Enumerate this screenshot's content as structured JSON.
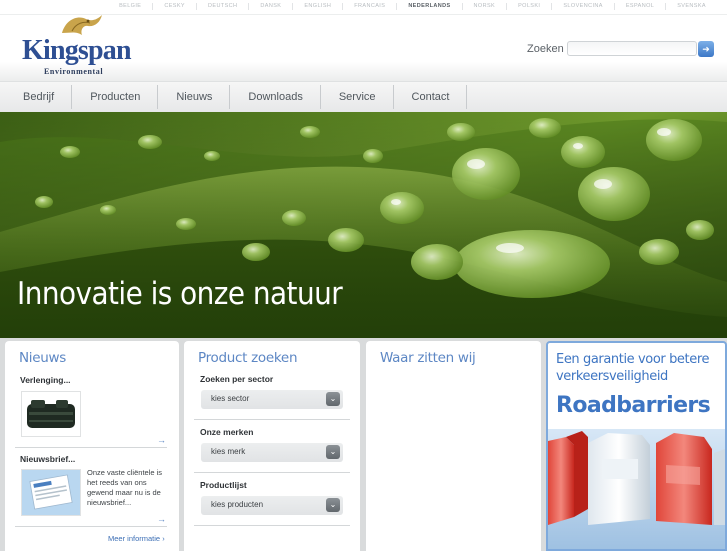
{
  "languages": [
    {
      "label": "BELGIE",
      "active": false
    },
    {
      "label": "CESKY",
      "active": false
    },
    {
      "label": "DEUTSCH",
      "active": false
    },
    {
      "label": "DANSK",
      "active": false
    },
    {
      "label": "ENGLISH",
      "active": false
    },
    {
      "label": "FRANCAIS",
      "active": false
    },
    {
      "label": "NEDERLANDS",
      "active": true
    },
    {
      "label": "NORSK",
      "active": false
    },
    {
      "label": "POLSKI",
      "active": false
    },
    {
      "label": "SLOVENCINA",
      "active": false
    },
    {
      "label": "ESPANOL",
      "active": false
    },
    {
      "label": "SVENSKA",
      "active": false
    }
  ],
  "logo": {
    "word": "Kingspan",
    "sub": "Environmental"
  },
  "search": {
    "label": "Zoeken",
    "placeholder": "",
    "button_icon": "arrow-right-icon"
  },
  "nav": {
    "items": [
      "Bedrijf",
      "Producten",
      "Nieuws",
      "Downloads",
      "Service",
      "Contact"
    ]
  },
  "hero": {
    "caption": "Innovatie is onze natuur"
  },
  "news": {
    "title": "Nieuws",
    "item1_title": "Verlenging...",
    "item2_title": "Nieuwsbrief...",
    "item2_text": "Onze vaste cliëntele is het reeds van ons gewend maar nu is de nieuwsbrief...",
    "more_link": "Meer informatie",
    "more_arrow": "›",
    "arrow": "→"
  },
  "product": {
    "title": "Product zoeken",
    "sector_label": "Zoeken per sector",
    "sector_value": "kies sector",
    "brands_label": "Onze merken",
    "brands_value": "kies merk",
    "list_label": "Productlijst",
    "list_value": "kies producten",
    "chevron": "⌄"
  },
  "locations": {
    "title": "Waar zitten wij"
  },
  "banner": {
    "slogan": "Een garantie voor betere verkeersveiligheid",
    "title": "Roadbarriers"
  },
  "colors": {
    "brand_blue": "#2e4f93",
    "accent_blue": "#5d87c4",
    "hero_green": "#4d7a1f"
  }
}
